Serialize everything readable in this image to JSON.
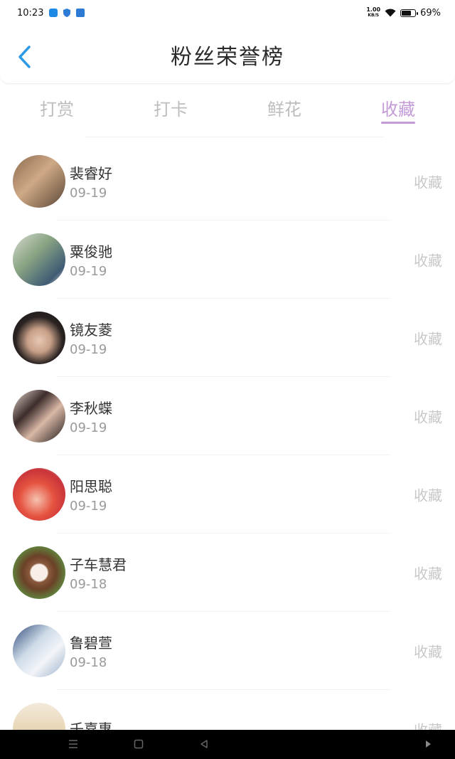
{
  "status_bar": {
    "time": "10:23",
    "net_speed_value": "1.00",
    "net_speed_unit": "KB/S",
    "battery_percent": "69%",
    "battery_level": 0.69
  },
  "header": {
    "title": "粉丝荣誉榜"
  },
  "tabs": [
    {
      "label": "打赏",
      "active": false
    },
    {
      "label": "打卡",
      "active": false
    },
    {
      "label": "鲜花",
      "active": false
    },
    {
      "label": "收藏",
      "active": true
    }
  ],
  "colors": {
    "accent": "#c39bd6",
    "back_icon": "#2f9be6",
    "inactive_tab": "#bdbdbd",
    "action_text": "#c8c8c8"
  },
  "fans": [
    {
      "name": "裴睿好",
      "date": "09-19",
      "action": "收藏"
    },
    {
      "name": "粟俊驰",
      "date": "09-19",
      "action": "收藏"
    },
    {
      "name": "镜友菱",
      "date": "09-19",
      "action": "收藏"
    },
    {
      "name": "李秋蝶",
      "date": "09-19",
      "action": "收藏"
    },
    {
      "name": "阳思聪",
      "date": "09-19",
      "action": "收藏"
    },
    {
      "name": "子车慧君",
      "date": "09-18",
      "action": "收藏"
    },
    {
      "name": "鲁碧萱",
      "date": "09-18",
      "action": "收藏"
    },
    {
      "name": "壬嘉惠",
      "date": "",
      "action": "收藏"
    }
  ]
}
